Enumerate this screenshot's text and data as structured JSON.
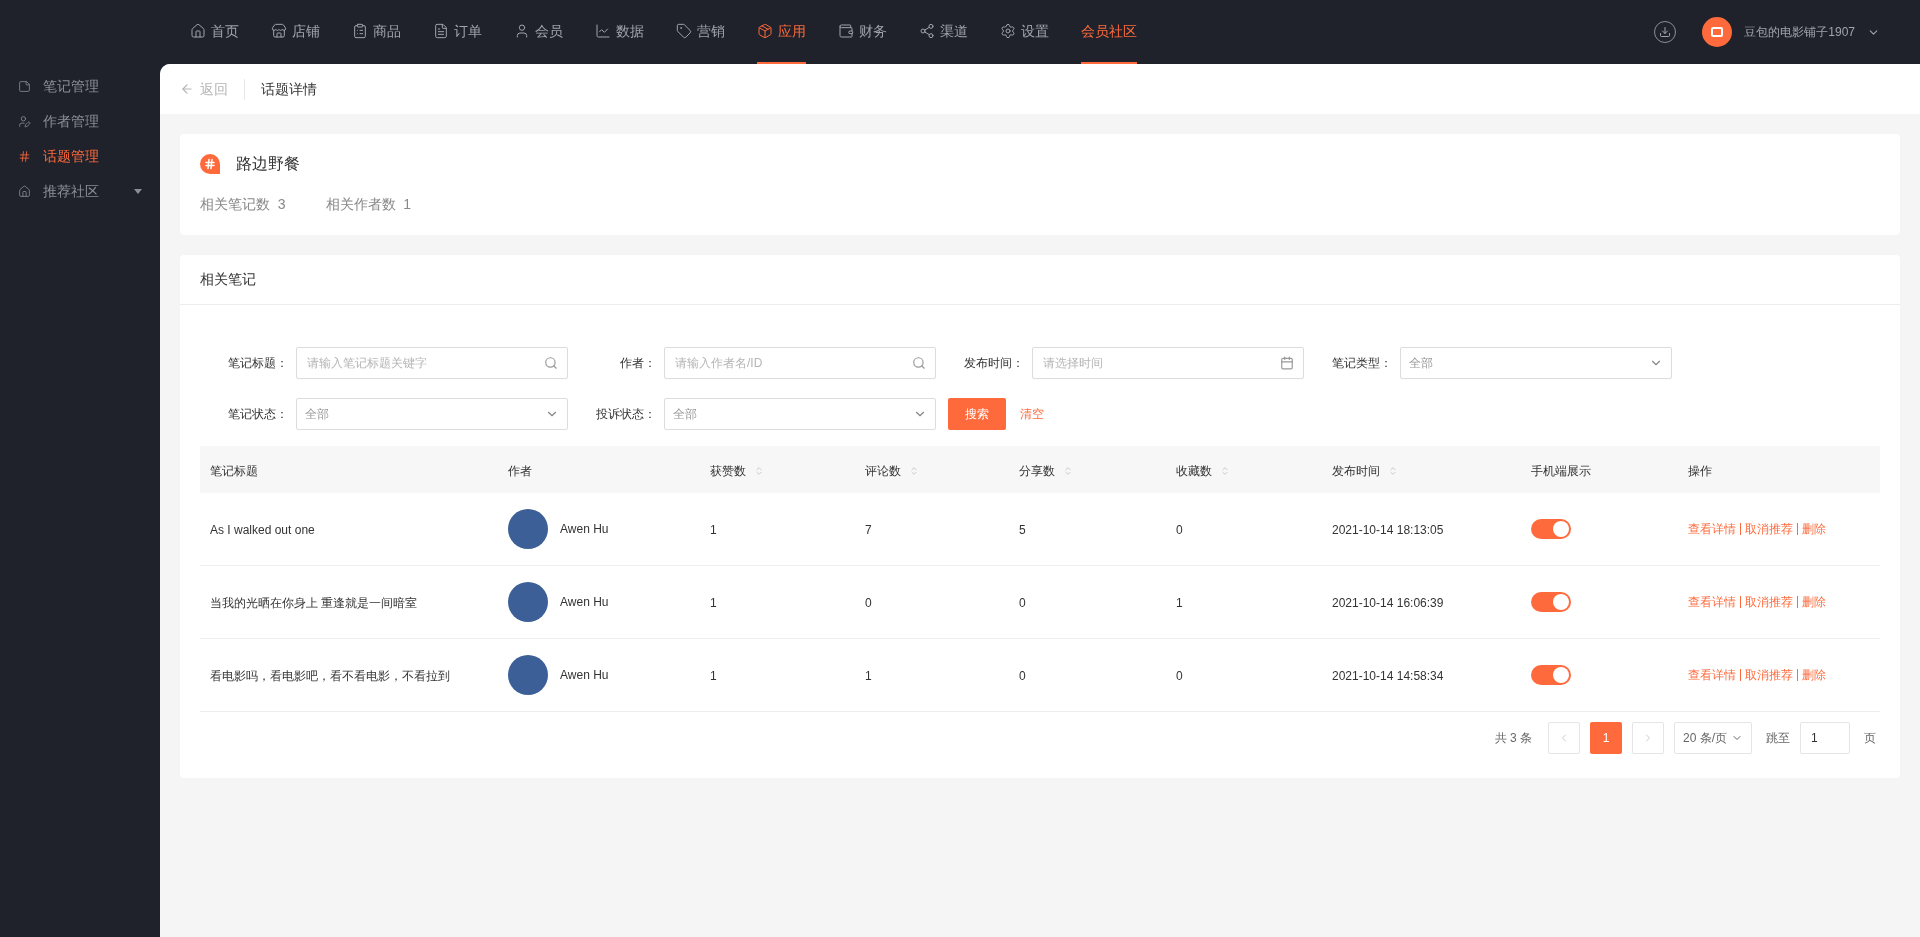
{
  "top_nav": {
    "items": [
      {
        "label": "首页",
        "selected": false
      },
      {
        "label": "店铺",
        "selected": false
      },
      {
        "label": "商品",
        "selected": false
      },
      {
        "label": "订单",
        "selected": false
      },
      {
        "label": "会员",
        "selected": false
      },
      {
        "label": "数据",
        "selected": false
      },
      {
        "label": "营销",
        "selected": false
      },
      {
        "label": "应用",
        "selected": true
      },
      {
        "label": "财务",
        "selected": false
      },
      {
        "label": "渠道",
        "selected": false
      },
      {
        "label": "设置",
        "selected": false
      },
      {
        "label": "会员社区",
        "selected": true
      }
    ],
    "account": "豆包的电影铺子1907"
  },
  "sidebar": {
    "items": [
      {
        "label": "笔记管理",
        "selected": false,
        "has_caret": false
      },
      {
        "label": "作者管理",
        "selected": false,
        "has_caret": false
      },
      {
        "label": "话题管理",
        "selected": true,
        "has_caret": false
      },
      {
        "label": "推荐社区",
        "selected": false,
        "has_caret": true
      }
    ]
  },
  "header": {
    "back": "返回",
    "title": "话题详情"
  },
  "topic": {
    "name": "路边野餐",
    "stats": [
      {
        "label": "相关笔记数",
        "value": "3"
      },
      {
        "label": "相关作者数",
        "value": "1"
      }
    ]
  },
  "notes": {
    "title": "相关笔记",
    "filters": [
      {
        "label": "笔记标题：",
        "kind": "search",
        "placeholder": "请输入笔记标题关键字"
      },
      {
        "label": "作者：",
        "kind": "search",
        "placeholder": "请输入作者名/ID"
      },
      {
        "label": "发布时间：",
        "kind": "date",
        "placeholder": "请选择时间"
      },
      {
        "label": "笔记类型：",
        "kind": "select",
        "value": "全部"
      },
      {
        "label": "笔记状态：",
        "kind": "select",
        "value": "全部"
      },
      {
        "label": "投诉状态：",
        "kind": "select",
        "value": "全部"
      }
    ],
    "search_button": "搜索",
    "clear_button": "清空",
    "table": {
      "columns": [
        {
          "label": "笔记标题",
          "sortable": false
        },
        {
          "label": "作者",
          "sortable": false
        },
        {
          "label": "获赞数",
          "sortable": true
        },
        {
          "label": "评论数",
          "sortable": true
        },
        {
          "label": "分享数",
          "sortable": true
        },
        {
          "label": "收藏数",
          "sortable": true
        },
        {
          "label": "发布时间",
          "sortable": true
        },
        {
          "label": "手机端展示",
          "sortable": false
        },
        {
          "label": "操作",
          "sortable": false
        }
      ],
      "rows": [
        {
          "title": "As I walked out one",
          "author": "Awen Hu",
          "likes": "1",
          "comments": "7",
          "shares": "5",
          "favorites": "0",
          "time": "2021-10-14 18:13:05",
          "mobile_on": true,
          "actions": [
            "查看详情",
            "取消推荐",
            "删除"
          ]
        },
        {
          "title": "当我的光晒在你身上 重逢就是一间暗室",
          "author": "Awen Hu",
          "likes": "1",
          "comments": "0",
          "shares": "0",
          "favorites": "1",
          "time": "2021-10-14 16:06:39",
          "mobile_on": true,
          "actions": [
            "查看详情",
            "取消推荐",
            "删除"
          ]
        },
        {
          "title": "看电影吗，看电影吧，看不看电影，不看拉到",
          "author": "Awen Hu",
          "likes": "1",
          "comments": "1",
          "shares": "0",
          "favorites": "0",
          "time": "2021-10-14 14:58:34",
          "mobile_on": true,
          "actions": [
            "查看详情",
            "取消推荐",
            "删除"
          ]
        }
      ]
    },
    "pagination": {
      "total": "共 3 条",
      "pages": [
        {
          "label": "1",
          "selected": true
        }
      ],
      "page_size": "20 条/页",
      "jump_label": "跳至",
      "jump_value": "1",
      "page_suffix": "页"
    }
  }
}
